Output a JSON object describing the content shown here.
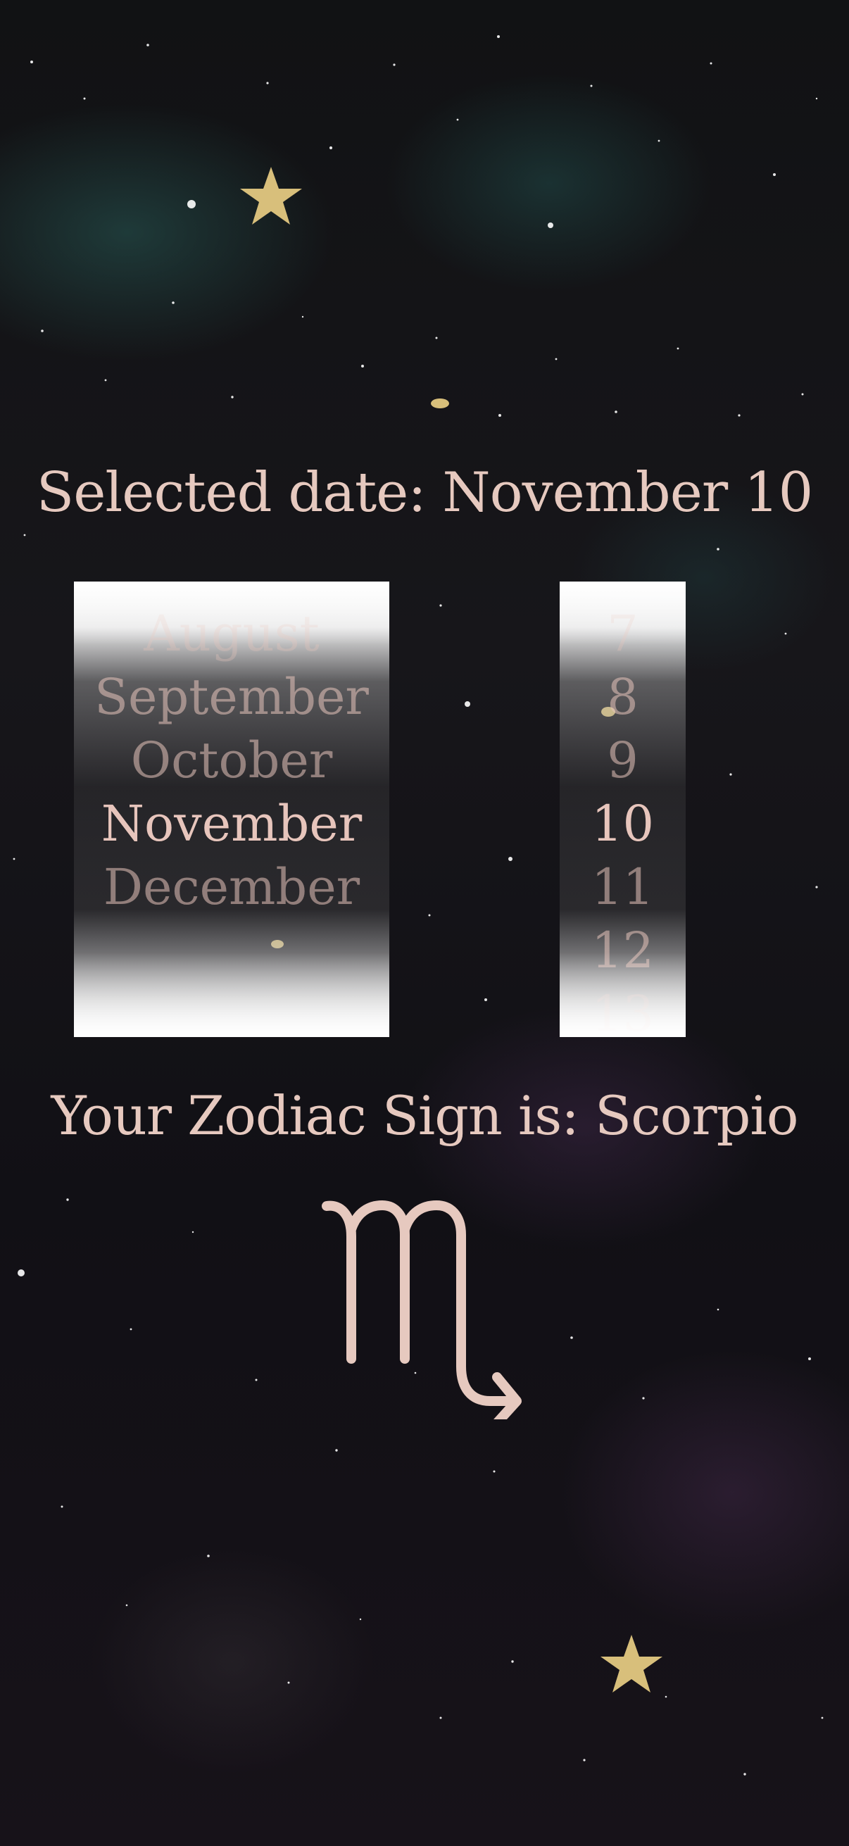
{
  "selected_date_text": "Selected date: November 10",
  "month_picker": {
    "items": [
      "August",
      "September",
      "October",
      "November",
      "December"
    ],
    "selected": "November"
  },
  "day_picker": {
    "items": [
      "7",
      "8",
      "9",
      "10",
      "11",
      "12",
      "13"
    ],
    "selected": "10"
  },
  "zodiac_text": "Your Zodiac Sign is: Scorpio",
  "zodiac_symbol": "scorpio-icon",
  "colors": {
    "text": "#e6c9bf",
    "background": "#111014"
  }
}
